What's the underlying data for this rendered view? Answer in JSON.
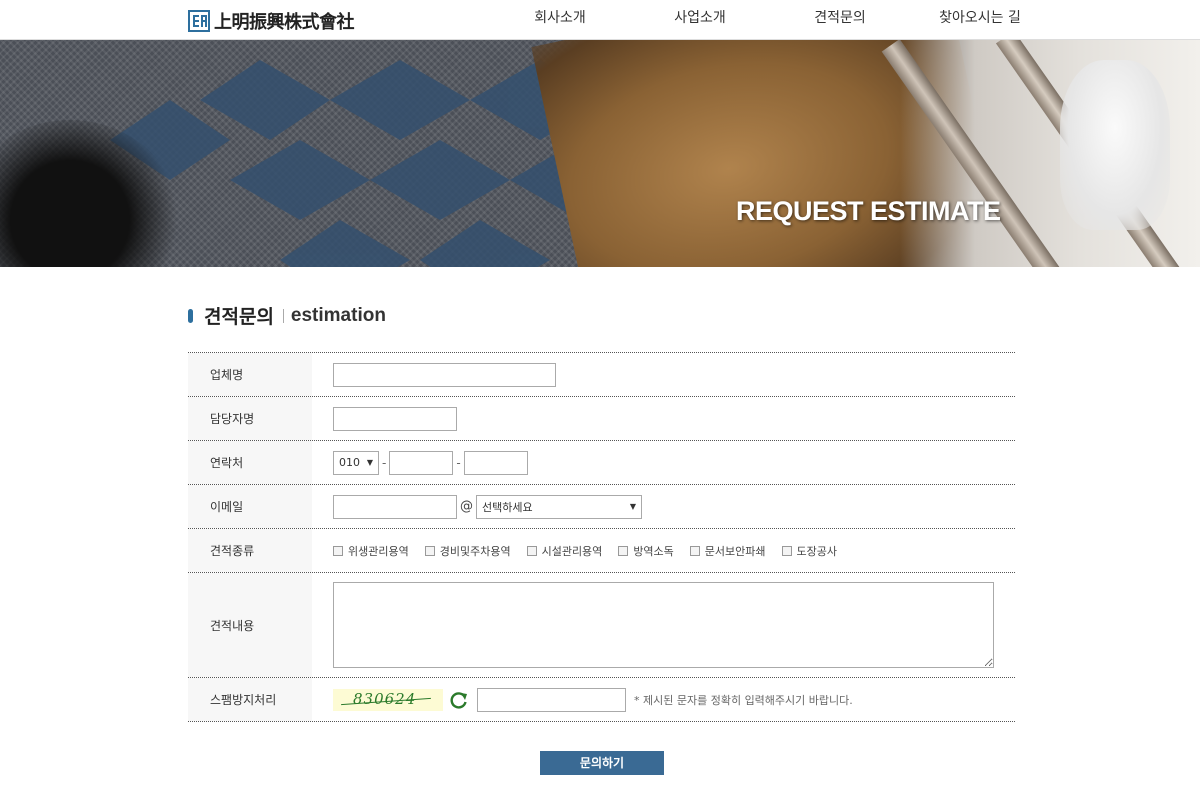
{
  "header": {
    "logo_text": "上明振興株式會社",
    "logo_icon": "company-logo-mark",
    "nav": [
      "회사소개",
      "사업소개",
      "견적문의",
      "찾아오시는 길"
    ]
  },
  "banner": {
    "title": "REQUEST ESTIMATE"
  },
  "section": {
    "title_ko": "견적문의",
    "title_en": "estimation"
  },
  "form": {
    "company_label": "업체명",
    "manager_label": "담당자명",
    "phone_label": "연락처",
    "phone_prefix": "010",
    "phone_sep": "-",
    "email_label": "이메일",
    "email_at": "@",
    "email_domain_selected": "선택하세요",
    "type_label": "견적종류",
    "types": [
      "위생관리용역",
      "경비및주차용역",
      "시설관리용역",
      "방역소독",
      "문서보안파쇄",
      "도장공사"
    ],
    "content_label": "견적내용",
    "spam_label": "스팸방지처리",
    "captcha_text": "830624",
    "captcha_note": "* 제시된 문자를 정확히 입력해주시기 바랍니다.",
    "refresh_icon": "refresh-icon"
  },
  "submit_label": "문의하기",
  "colors": {
    "accent": "#2d6f9e",
    "button": "#3a6a94",
    "captcha_text": "#2b7a2b",
    "captcha_bg": "#fdfbd4"
  }
}
